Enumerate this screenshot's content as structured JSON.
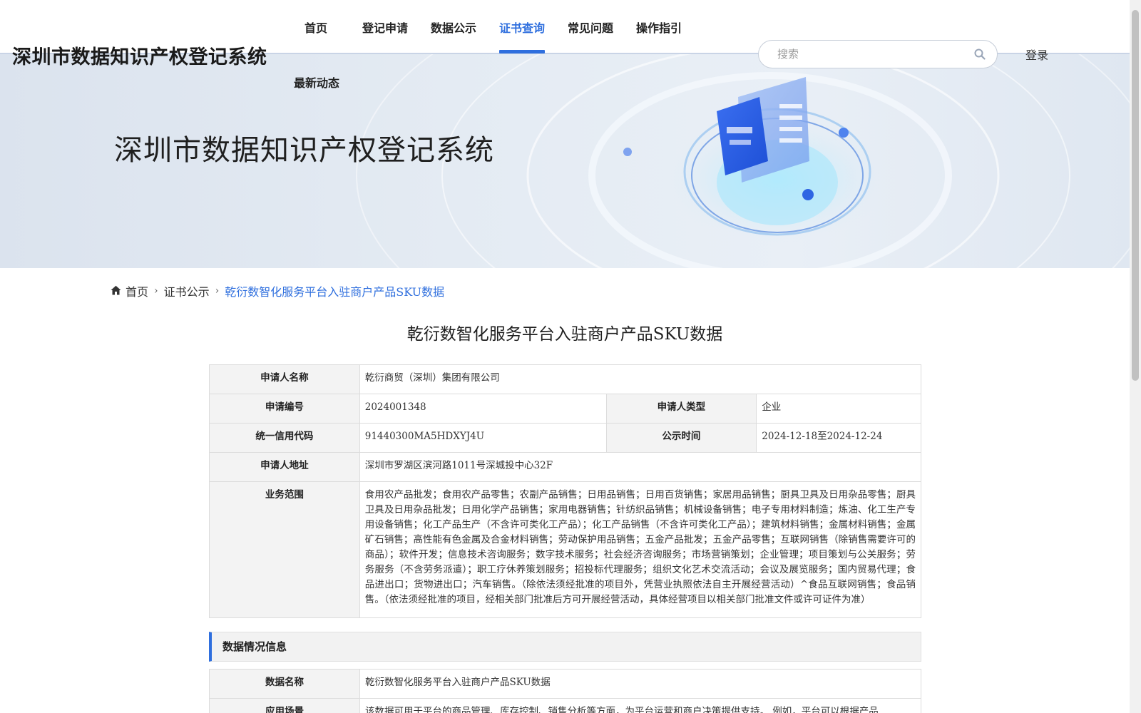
{
  "header": {
    "site_title": "深圳市数据知识产权登记系统",
    "nav": [
      {
        "label": "首页",
        "active": false
      },
      {
        "label": "登记申请",
        "active": false
      },
      {
        "label": "数据公示",
        "active": false
      },
      {
        "label": "证书查询",
        "active": true
      },
      {
        "label": "常见问题",
        "active": false
      },
      {
        "label": "操作指引",
        "active": false
      },
      {
        "label": "最新动态",
        "active": false
      }
    ],
    "search_placeholder": "搜索",
    "login_label": "登录",
    "accent_color": "#2f6fde"
  },
  "banner": {
    "title": "深圳市数据知识产权登记系统"
  },
  "breadcrumb": {
    "home": "首页",
    "level2": "证书公示",
    "current": "乾衍数智化服务平台入驻商户产品SKU数据"
  },
  "document": {
    "title": "乾衍数智化服务平台入驻商户产品SKU数据",
    "applicant_name_label": "申请人名称",
    "applicant_name": "乾衍商贸（深圳）集团有限公司",
    "app_no_label": "申请编号",
    "app_no": "2024001348",
    "applicant_type_label": "申请人类型",
    "applicant_type": "企业",
    "credit_code_label": "统一信用代码",
    "credit_code": "91440300MA5HDXYJ4U",
    "publicity_time_label": "公示时间",
    "publicity_time": "2024-12-18至2024-12-24",
    "address_label": "申请人地址",
    "address": "深圳市罗湖区滨河路1011号深城投中心32F",
    "scope_label": "业务范围",
    "scope": "食用农产品批发；食用农产品零售；农副产品销售；日用品销售；日用百货销售；家居用品销售；厨具卫具及日用杂品零售；厨具卫具及日用杂品批发；日用化学产品销售；家用电器销售；针纺织品销售；机械设备销售；电子专用材料制造；炼油、化工生产专用设备销售；化工产品生产（不含许可类化工产品）；化工产品销售（不含许可类化工产品）；建筑材料销售；金属材料销售；金属矿石销售；高性能有色金属及合金材料销售；劳动保护用品销售；五金产品批发；五金产品零售；互联网销售（除销售需要许可的商品）；软件开发；信息技术咨询服务；数字技术服务；社会经济咨询服务；市场营销策划；企业管理；项目策划与公关服务；劳务服务（不含劳务派遣）；职工疗休养策划服务；招投标代理服务；组织文化艺术交流活动；会议及展览服务；国内贸易代理；食品进出口；货物进出口；汽车销售。（除依法须经批准的项目外，凭营业执照依法自主开展经营活动）^食品互联网销售；食品销售。（依法须经批准的项目，经相关部门批准后方可开展经营活动，具体经营项目以相关部门批准文件或许可证件为准）"
  },
  "data_section": {
    "title": "数据情况信息",
    "data_name_label": "数据名称",
    "data_name": "乾衍数智化服务平台入驻商户产品SKU数据",
    "scenario_label": "应用场景",
    "scenario": "该数据可用于平台的商品管理、库存控制、销售分析等方面，为平台运营和商户决策提供支持。 例如，平台可以根据产品"
  }
}
